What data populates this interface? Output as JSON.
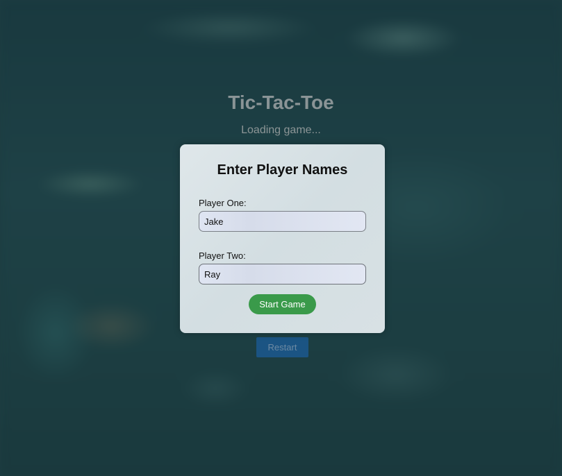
{
  "page": {
    "title": "Tic-Tac-Toe",
    "status": "Loading game...",
    "restart_label": "Restart"
  },
  "modal": {
    "heading": "Enter Player Names",
    "player_one": {
      "label": "Player One:",
      "value": "Jake"
    },
    "player_two": {
      "label": "Player Two:",
      "value": "Ray"
    },
    "start_label": "Start Game"
  },
  "colors": {
    "start_button": "#3a9a4a",
    "restart_button": "#1b5483",
    "background": "#1d3d42"
  }
}
